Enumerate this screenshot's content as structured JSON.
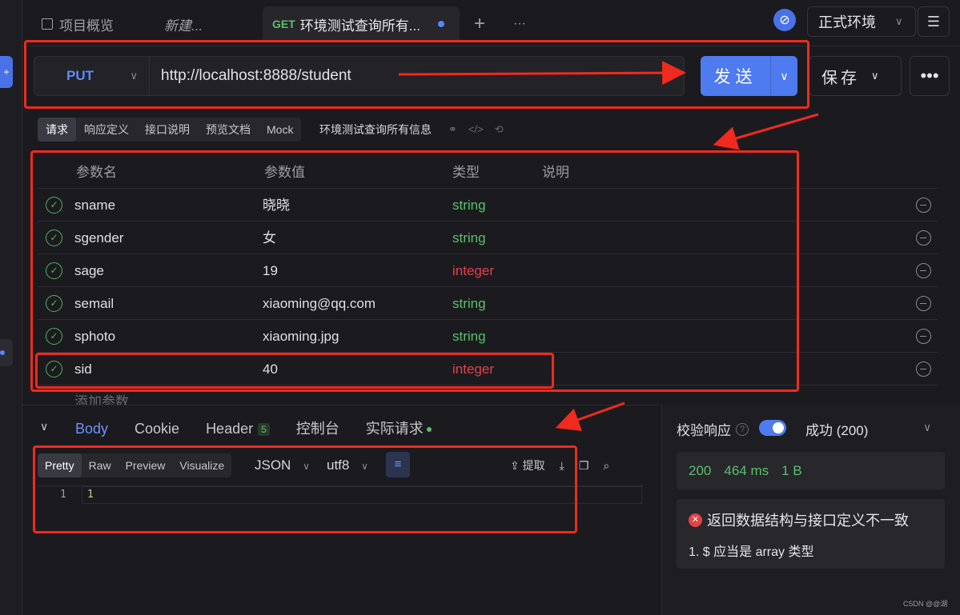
{
  "tabs": {
    "overview": "项目概览",
    "new": "新建...",
    "active_method": "GET",
    "active_title": "环境测试查询所有...",
    "add": "+",
    "more": "···"
  },
  "env": {
    "name": "正式环境"
  },
  "request": {
    "method": "PUT",
    "url": "http://localhost:8888/student",
    "send_label": "发送",
    "save_label": "保存"
  },
  "subtabs": [
    "请求",
    "响应定义",
    "接口说明",
    "预览文档",
    "Mock"
  ],
  "api_name": "环境测试查询所有信息",
  "params": {
    "headers": [
      "参数名",
      "参数值",
      "类型",
      "说明"
    ],
    "rows": [
      {
        "name": "sname",
        "value": "晓晓",
        "type": "string"
      },
      {
        "name": "sgender",
        "value": "女",
        "type": "string"
      },
      {
        "name": "sage",
        "value": "19",
        "type": "integer"
      },
      {
        "name": "semail",
        "value": "xiaoming@qq.com",
        "type": "string"
      },
      {
        "name": "sphoto",
        "value": "xiaoming.jpg",
        "type": "string"
      },
      {
        "name": "sid",
        "value": "40",
        "type": "integer"
      }
    ],
    "add_label": "添加参数"
  },
  "response": {
    "tabs": [
      "Body",
      "Cookie",
      "Header",
      "控制台",
      "实际请求"
    ],
    "header_count": "5",
    "view_tabs": [
      "Pretty",
      "Raw",
      "Preview",
      "Visualize"
    ],
    "format": "JSON",
    "encoding": "utf8",
    "extract_label": "提取",
    "line_number": "1",
    "body": "1"
  },
  "verify": {
    "label": "校验响应",
    "status": "成功 (200)",
    "code": "200",
    "time": "464 ms",
    "size": "1 B",
    "error_title": "返回数据结构与接口定义不一致",
    "error_item": "1. $ 应当是 array 类型"
  },
  "watermark": "CSDN @@湖",
  "colors": {
    "accent": "#4f7bf0",
    "string": "#5cc06a",
    "integer": "#e0434a",
    "annotation": "#f02a1e"
  }
}
